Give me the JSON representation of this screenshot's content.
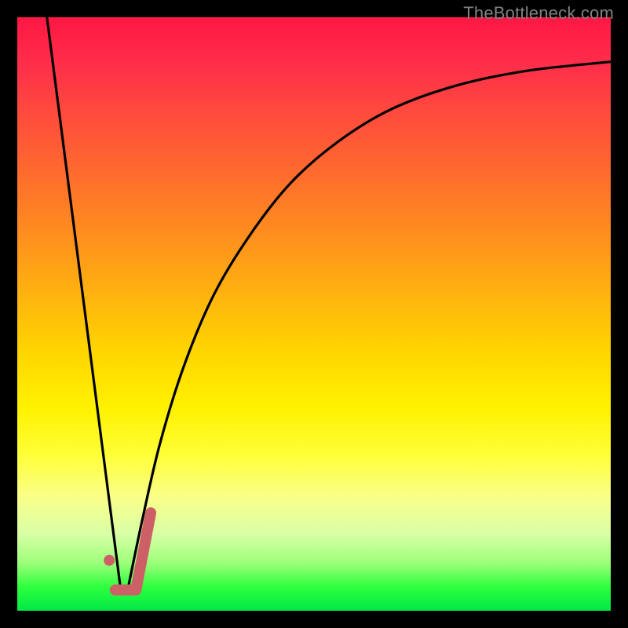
{
  "watermark": "TheBottleneck.com",
  "chart_data": {
    "type": "line",
    "title": "",
    "xlabel": "",
    "ylabel": "",
    "xlim": [
      0,
      100
    ],
    "ylim": [
      0,
      100
    ],
    "grid": false,
    "legend": false,
    "series": [
      {
        "name": "left-descent",
        "x": [
          5.0,
          17.5
        ],
        "values": [
          100,
          3
        ]
      },
      {
        "name": "right-ascent",
        "x": [
          18.5,
          21,
          24,
          28,
          33,
          39,
          46,
          54,
          63,
          74,
          86,
          100
        ],
        "values": [
          3,
          15,
          28,
          41,
          53,
          63,
          72,
          79,
          84.5,
          88.5,
          91,
          92.5
        ]
      }
    ],
    "annotations": {
      "marker": {
        "type": "J-mark",
        "dot": {
          "x": 15.5,
          "y": 8.5
        },
        "path": [
          {
            "x": 16.5,
            "y": 3.5
          },
          {
            "x": 20.0,
            "y": 3.5
          },
          {
            "x": 22.5,
            "y": 16.5
          }
        ]
      }
    },
    "background_gradient": [
      "#ff1744",
      "#ff8c1f",
      "#ffff3a",
      "#00e846"
    ]
  }
}
